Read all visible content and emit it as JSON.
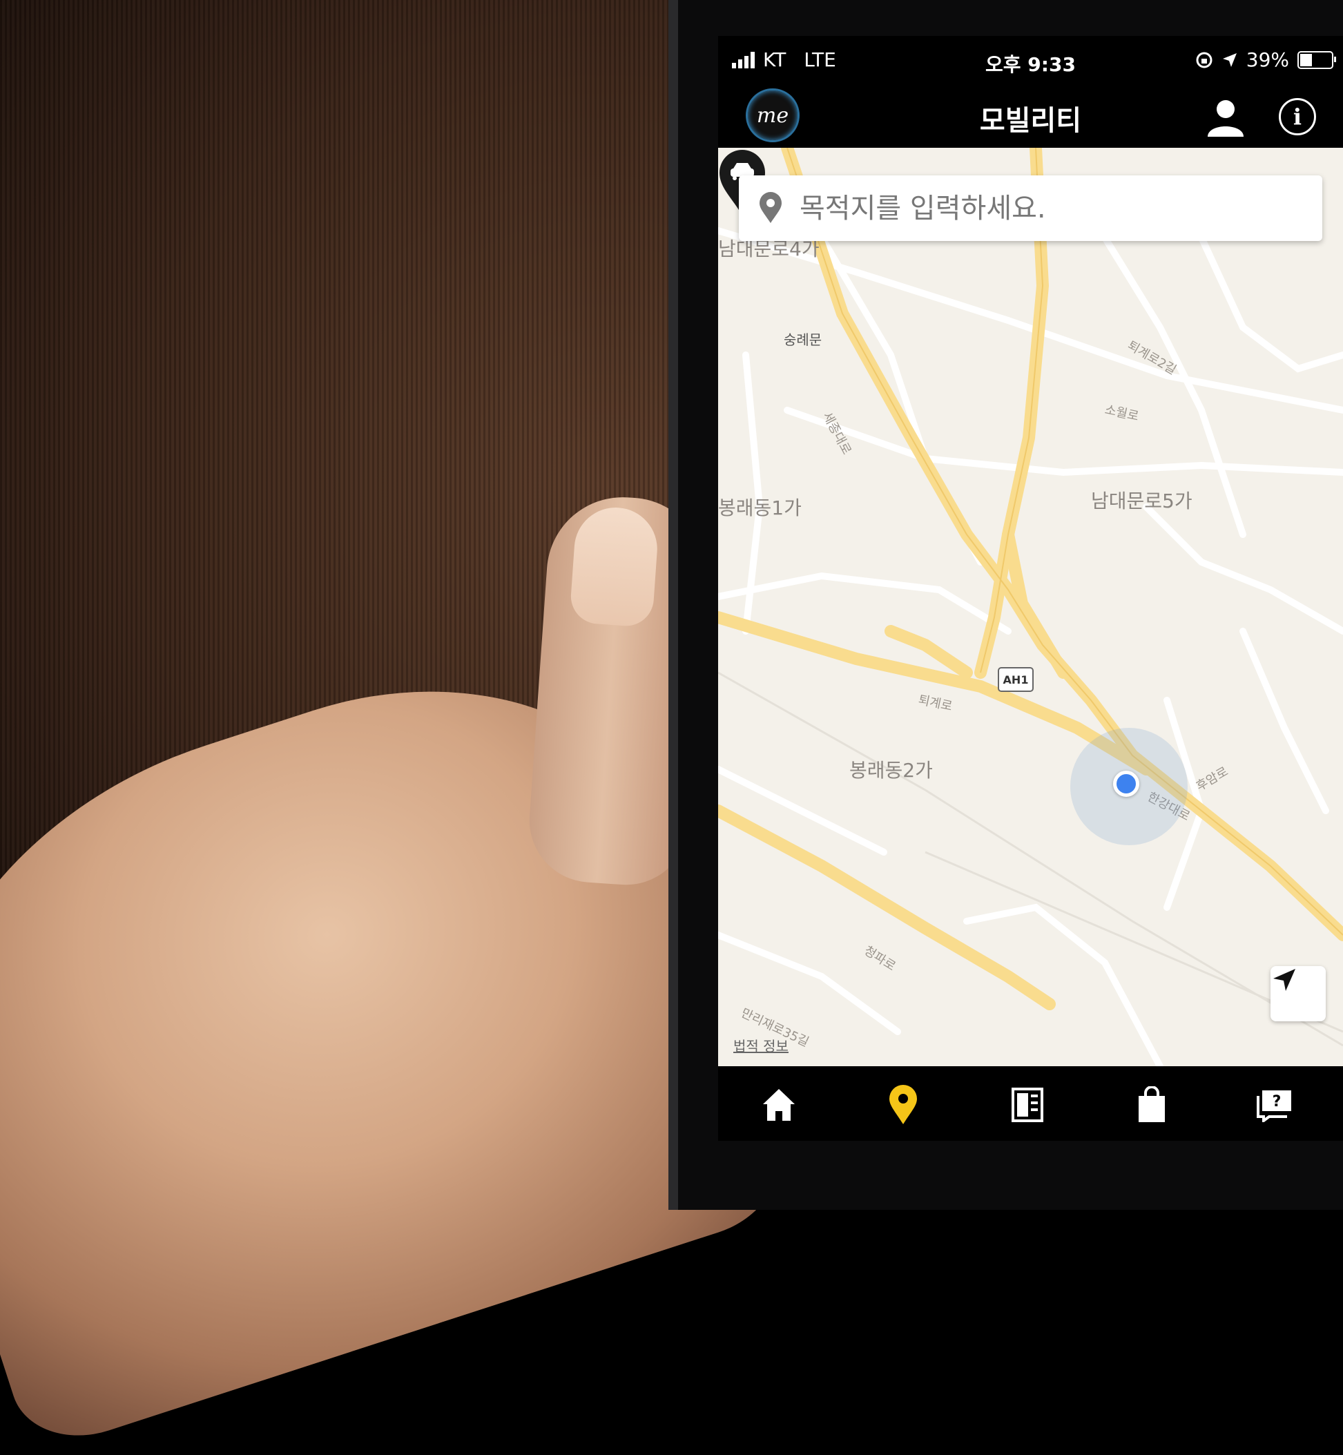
{
  "status_bar": {
    "carrier": "KT",
    "network": "LTE",
    "time": "오후 9:33",
    "battery": "39%",
    "battery_level": 0.39
  },
  "app_bar": {
    "logo_text": "me",
    "title": "모빌리티",
    "icons": [
      "user-icon",
      "info-icon"
    ]
  },
  "search": {
    "placeholder": "목적지를 입력하세요."
  },
  "map": {
    "labels": {
      "namdaemunro4ga": "남대문로4가",
      "sungnyemun": "숭례문",
      "bongnaedong1ga": "봉래동1가",
      "namdaemunro5ga": "남대문로5가",
      "bongnaedong2ga": "봉래동2가",
      "sejongdaero": "세종대로",
      "toegyero": "퇴계로",
      "hangangdaero": "한강대로",
      "cheongparo": "청파로",
      "huamro": "후암로",
      "toegyero_2gil": "퇴계로2길",
      "sowolro": "소월로",
      "mangwolro": "만리재로35길"
    },
    "route_badge": "AH1",
    "legal_link": "법적 정보",
    "markers": [
      "car-marker",
      "current-location"
    ]
  },
  "tab_bar": {
    "tabs": [
      {
        "icon": "home-icon",
        "active": false
      },
      {
        "icon": "location-pin-icon",
        "active": true
      },
      {
        "icon": "news-icon",
        "active": false
      },
      {
        "icon": "shopping-bag-icon",
        "active": false
      },
      {
        "icon": "help-chat-icon",
        "active": false
      }
    ],
    "active_color": "#f5c518"
  },
  "colors": {
    "map_background": "#f4f1ea",
    "major_road": "#f9dc8e",
    "minor_road": "#ffffff",
    "location_dot": "#3d82ef"
  }
}
